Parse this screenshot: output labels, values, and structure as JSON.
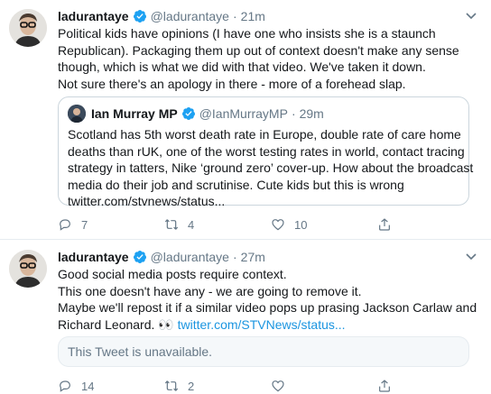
{
  "tweets": [
    {
      "name": "ladurantaye",
      "handle": "@ladurantaye",
      "time": "21m",
      "lines": [
        "Political kids have opinions (I have one who insists she is a staunch",
        "Republican).  Packaging them up out of context doesn't make any sense",
        "though, which is what we did with that video. We've taken it down.",
        "Not sure there's an apology in there - more of a forehead slap."
      ],
      "quote": {
        "name": "Ian Murray MP",
        "handle": "@IanMurrayMP",
        "time": "29m",
        "lines": [
          "Scotland has 5th worst death rate in Europe, double rate of care home",
          "deaths than rUK, one of the worst testing rates in world, contact tracing",
          "strategy in tatters, Nike ‘ground zero’ cover-up. How about the broadcast",
          "media do their job and scrutinise. Cute kids but this is wrong",
          "twitter.com/stvnews/status..."
        ]
      },
      "replies": "7",
      "retweets": "4",
      "likes": "10"
    },
    {
      "name": "ladurantaye",
      "handle": "@ladurantaye",
      "time": "27m",
      "lines": [
        "Good social media posts require context.",
        "This one doesn't have any - we are going to remove it.",
        "Maybe we'll repost it if a similar video pops up prasing Jackson Carlaw and"
      ],
      "last_line_text": "Richard Leonard. 👀 ",
      "link": "twitter.com/STVNews/status...",
      "unavailable": "This Tweet is unavailable.",
      "replies": "14",
      "retweets": "2",
      "likes": ""
    }
  ],
  "colors": {
    "verified": "#1da1f2",
    "link": "#1b95e0",
    "muted": "#657786"
  },
  "icons": [
    "verified-badge-icon",
    "chevron-down-icon",
    "reply-icon",
    "retweet-icon",
    "like-icon",
    "share-icon"
  ]
}
